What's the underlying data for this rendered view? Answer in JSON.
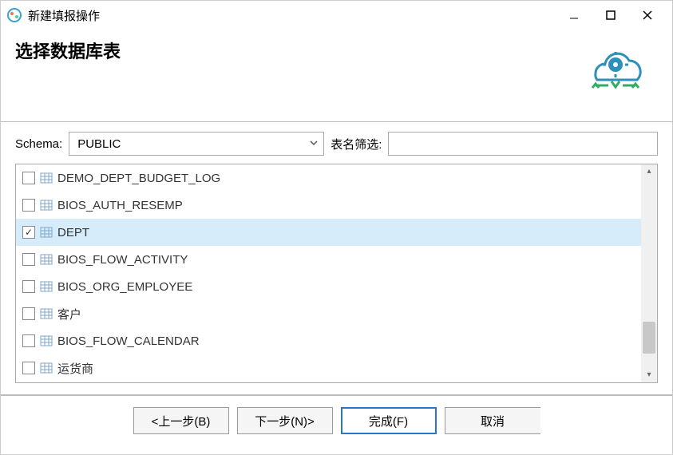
{
  "window": {
    "title": "新建填报操作"
  },
  "header": {
    "title": "选择数据库表"
  },
  "schema": {
    "label": "Schema:",
    "value": "PUBLIC",
    "filter_label": "表名筛选:",
    "filter_value": ""
  },
  "tables": [
    {
      "name": "DEMO_DEPT_BUDGET_LOG",
      "checked": false
    },
    {
      "name": "BIOS_AUTH_RESEMP",
      "checked": false
    },
    {
      "name": "DEPT",
      "checked": true
    },
    {
      "name": "BIOS_FLOW_ACTIVITY",
      "checked": false
    },
    {
      "name": "BIOS_ORG_EMPLOYEE",
      "checked": false
    },
    {
      "name": "客户",
      "checked": false
    },
    {
      "name": "BIOS_FLOW_CALENDAR",
      "checked": false
    },
    {
      "name": "运货商",
      "checked": false
    }
  ],
  "buttons": {
    "back": "<上一步(B)",
    "next": "下一步(N)>",
    "finish": "完成(F)",
    "cancel": "取消"
  }
}
